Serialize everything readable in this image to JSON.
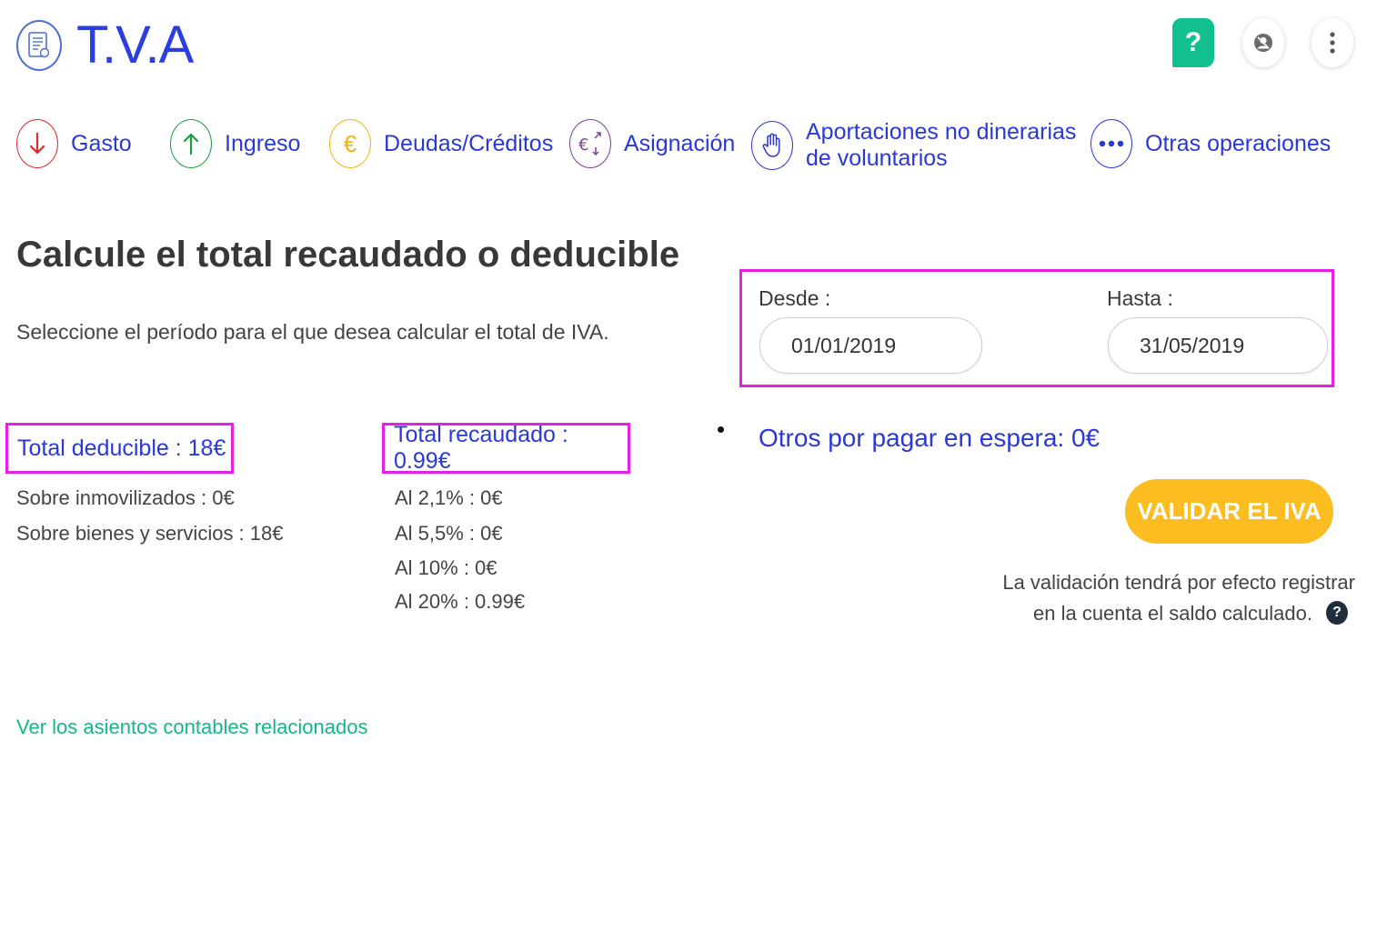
{
  "app": {
    "title": "T.V.A",
    "logo_icon": "document-receipt-icon"
  },
  "header_actions": [
    {
      "icon": "help-icon",
      "label": "?",
      "color": "#12c08e"
    },
    {
      "icon": "user-circle-icon"
    },
    {
      "icon": "more-vertical-icon"
    }
  ],
  "operations": [
    {
      "label": "Gasto",
      "icon": "arrow-down-icon",
      "color": "#e0262b"
    },
    {
      "label": "Ingreso",
      "icon": "arrow-up-icon",
      "color": "#1e9e3e"
    },
    {
      "label": "Deudas/Créditos",
      "icon": "euro-icon",
      "color": "#f3b21b"
    },
    {
      "label": "Asignación",
      "icon": "euro-transfer-icon",
      "color": "#7c3f98"
    },
    {
      "label_line1": "Aportaciones no dinerarias",
      "label_line2": "de voluntarios",
      "icon": "raised-hand-icon",
      "color": "#2a38d8"
    },
    {
      "label": "Otras operaciones",
      "icon": "more-dots-icon",
      "color": "#2a38d8"
    }
  ],
  "main": {
    "heading": "Calcule el total recaudado o deducible",
    "subtext": "Seleccione el período para el que desea calcular el total de IVA."
  },
  "period": {
    "from_label": "Desde :",
    "from_value": "01/01/2019",
    "to_label": "Hasta :",
    "to_value": "31/05/2019"
  },
  "deductible": {
    "title": "Total deducible : 18€",
    "lines": [
      "Sobre inmovilizados : 0€",
      "Sobre bienes y servicios : 18€"
    ]
  },
  "collected": {
    "title": "Total recaudado : 0.99€",
    "lines": [
      "Al 2,1% : 0€",
      "Al 5,5% : 0€",
      "Al 10% : 0€",
      "Al 20% : 0.99€"
    ]
  },
  "pending": "Otros por pagar en espera: 0€",
  "validate": {
    "button": "VALIDAR EL IVA",
    "color": "#fbbd1f",
    "note_line1": "La validación tendrá por efecto registrar",
    "note_line2": "en la cuenta el saldo calculado.",
    "help_icon_label": "?"
  },
  "entries_link": "Ver los asientos contables relacionados",
  "colors": {
    "primary": "#2a38d8",
    "highlight": "#e61ee8",
    "link_green": "#12b886"
  }
}
